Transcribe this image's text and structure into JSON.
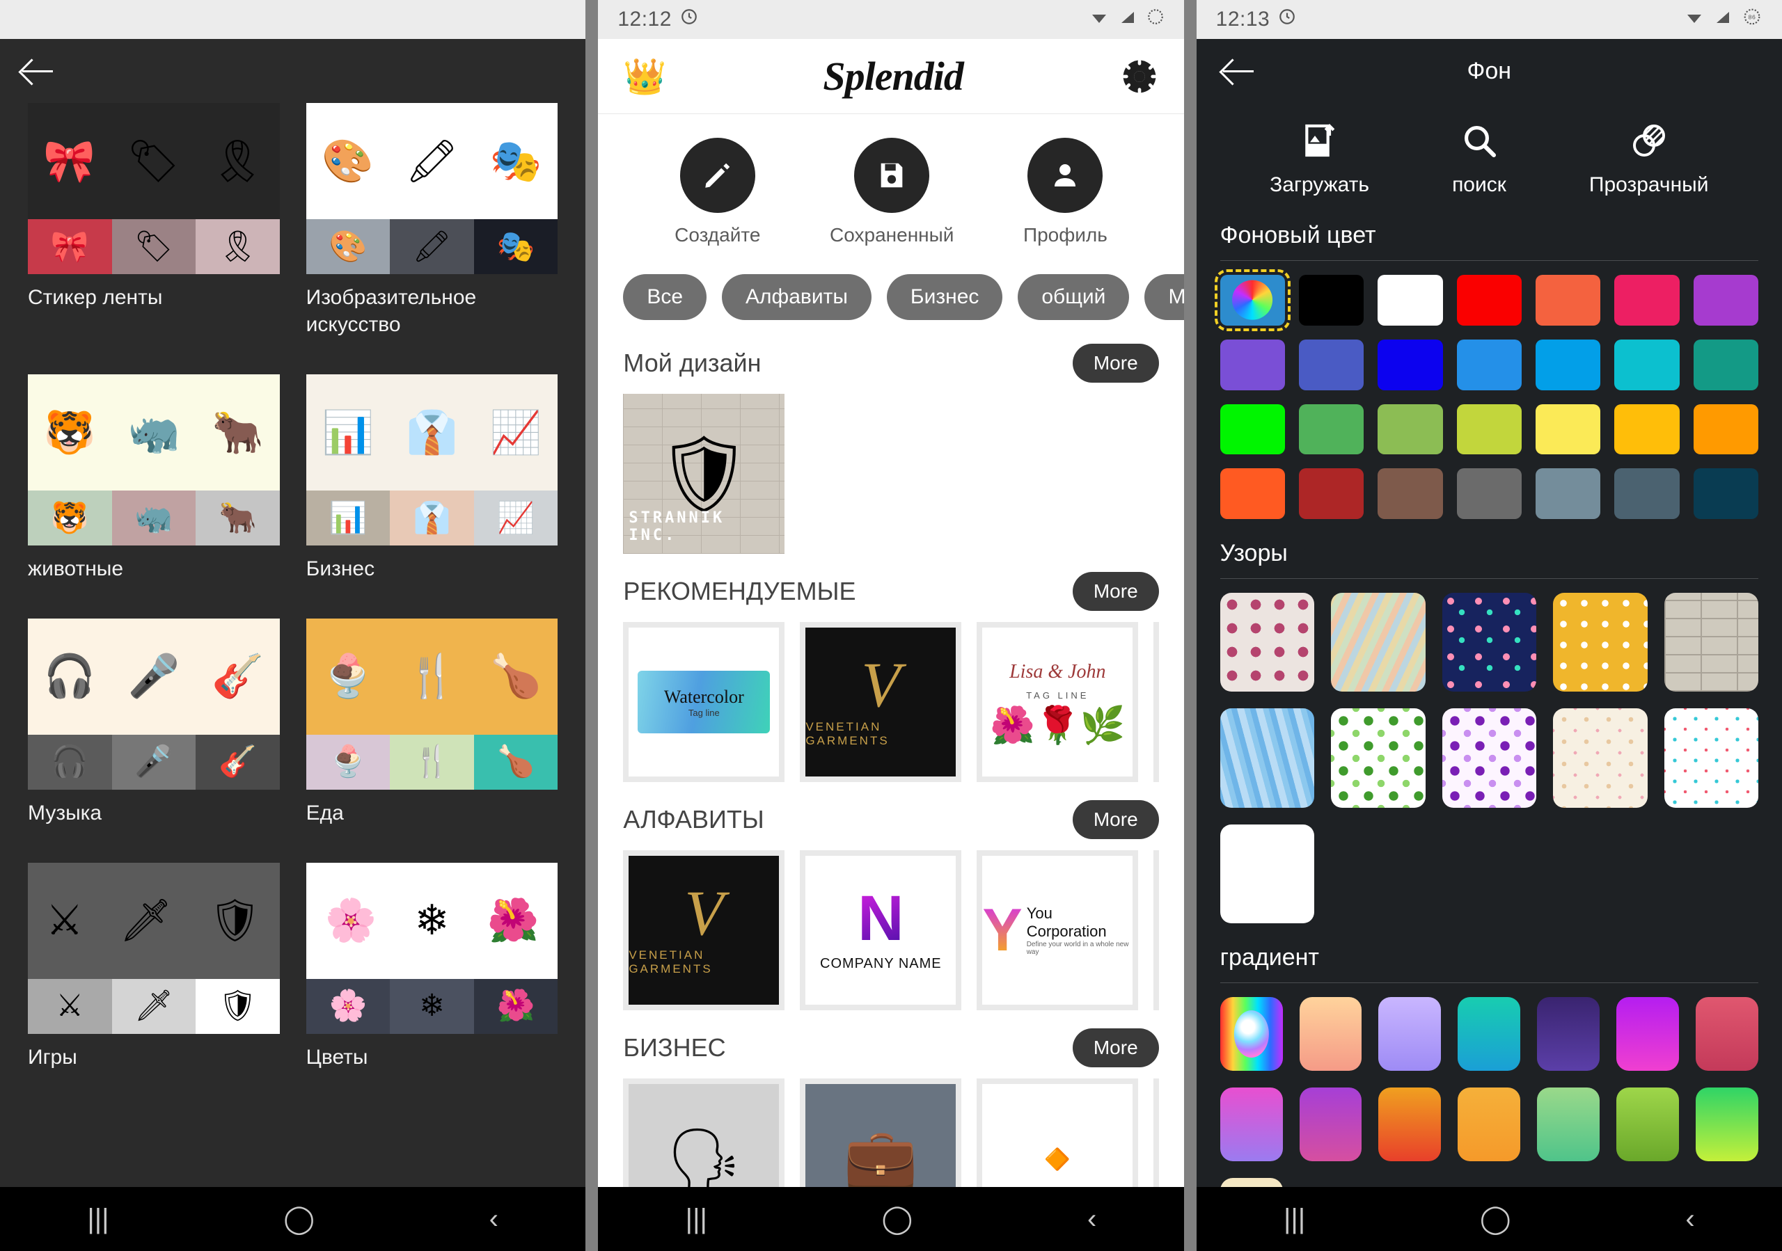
{
  "left": {
    "statusbar": {},
    "back_icon": "arrow-left-icon",
    "categories": [
      {
        "label": "Стикер ленты",
        "icons": [
          "🎀",
          "🏷",
          "🎗"
        ],
        "big_bg": "#262626",
        "cells": [
          "#c73a4a",
          "#9b8285",
          "#cdb4b7"
        ]
      },
      {
        "label": "Изобразительное искусство",
        "icons": [
          "🎨",
          "🖍",
          "🎭"
        ],
        "big_bg": "#ffffff",
        "cells": [
          "#9aa2ab",
          "#4c4f57",
          "#1a1d26"
        ]
      },
      {
        "label": "животные",
        "icons": [
          "🐯",
          "🦏",
          "🐂"
        ],
        "big_bg": "#fbfbe6",
        "cells": [
          "#bdd0bc",
          "#c0a2a2",
          "#c5c5c5"
        ]
      },
      {
        "label": "Бизнес",
        "icons": [
          "📊",
          "👔",
          "📈"
        ],
        "big_bg": "#f6f1e8",
        "cells": [
          "#b9b0a2",
          "#e8c9b6",
          "#cfd3d6"
        ]
      },
      {
        "label": "Музыка",
        "icons": [
          "🎧",
          "🎤",
          "🎸"
        ],
        "big_bg": "#fdf3e4",
        "cells": [
          "#5b5b5b",
          "#777777",
          "#4a4a4a"
        ]
      },
      {
        "label": "Еда",
        "icons": [
          "🍨",
          "🍴",
          "🍗"
        ],
        "big_bg": "#f0b44d",
        "cells": [
          "#d8c7d6",
          "#cfe3b8",
          "#39bfae"
        ]
      },
      {
        "label": "Игры",
        "icons": [
          "⚔",
          "🗡",
          "🛡"
        ],
        "big_bg": "#5b5b5b",
        "cells": [
          "#a9a9a9",
          "#d4d4d4",
          "#ffffff"
        ]
      },
      {
        "label": "Цветы",
        "icons": [
          "🌸",
          "❄",
          "🌺"
        ],
        "big_bg": "#ffffff",
        "cells": [
          "#3d4250",
          "#4b5160",
          "#2f3440"
        ]
      }
    ]
  },
  "mid": {
    "statusbar": {
      "time": "12:12"
    },
    "header": {
      "crown": "👑",
      "brand": "Splendid",
      "settings_icon": "gear-icon"
    },
    "actions": [
      {
        "label": "Создайте",
        "icon": "pencil-icon"
      },
      {
        "label": "Сохраненный",
        "icon": "save-icon"
      },
      {
        "label": "Профиль",
        "icon": "person-icon"
      }
    ],
    "chips": [
      "Все",
      "Алфавиты",
      "Бизнес",
      "общий",
      "Музыка"
    ],
    "sections": [
      {
        "title": "Мой дизайн",
        "more": "More",
        "kind": "mydesign",
        "items": [
          {
            "brand": "STRANNIK INC.",
            "emblem": "🛡"
          }
        ]
      },
      {
        "title": "РЕКОМЕНДУЕМЫЕ",
        "more": "More",
        "kind": "logos",
        "items": [
          {
            "type": "watercolor",
            "name": "Watercolor",
            "tagline": "Tag line"
          },
          {
            "type": "venetian",
            "letter": "V",
            "name": "VENETIAN GARMENTS"
          },
          {
            "type": "floral",
            "name": "Lisa & John",
            "tagline": "TAG LINE"
          }
        ]
      },
      {
        "title": "АЛФАВИТЫ",
        "more": "More",
        "kind": "logos",
        "items": [
          {
            "type": "venetian",
            "letter": "V",
            "name": "VENETIAN GARMENTS"
          },
          {
            "type": "nbrush",
            "letter": "N",
            "name": "COMPANY NAME"
          },
          {
            "type": "ycorp",
            "letter": "Y",
            "name": "You Corporation",
            "tagline": "Define your world in a whole new way"
          }
        ]
      },
      {
        "title": "БИЗНЕС",
        "more": "More",
        "kind": "logos",
        "items": [
          {
            "type": "meeting",
            "icon": "💬"
          },
          {
            "type": "briefcase",
            "icon": "💼"
          },
          {
            "type": "ribbonmark",
            "icon": "🔶"
          }
        ]
      }
    ]
  },
  "right": {
    "statusbar": {
      "time": "12:13",
      "battery": "86"
    },
    "appbar": {
      "back_icon": "arrow-left-icon",
      "title": "Фон"
    },
    "tools": [
      {
        "label": "Загружать",
        "icon": "image-upload-icon"
      },
      {
        "label": "поиск",
        "icon": "search-icon"
      },
      {
        "label": "Прозрачный",
        "icon": "transparency-icon"
      }
    ],
    "bg_color": {
      "title": "Фоновый цвет",
      "selected_index": 0,
      "swatches": [
        "picker",
        "#000000",
        "#ffffff",
        "#fa0000",
        "#f4623f",
        "#ed1f63",
        "#a63bcf",
        "#7a4fd6",
        "#4a5bc4",
        "#0c02ef",
        "#2490e8",
        "#029fe8",
        "#0cc0cf",
        "#139a86",
        "#00f500",
        "#50b25a",
        "#8cbd54",
        "#c2d63c",
        "#fbea57",
        "#ffbe09",
        "#ff9a00",
        "#ff5a22",
        "#ad2626",
        "#7e5a4b",
        "#6b6b6b",
        "#748d9b",
        "#4b6270",
        "#093c52"
      ]
    },
    "patterns": {
      "title": "Узоры",
      "items": [
        "polka-dots-pink",
        "feather-leaves",
        "flamingo-navy",
        "daisy-yellow",
        "brick-wall",
        "blue-streaks",
        "green-dots",
        "purple-dots",
        "sweets-cream",
        "summer-icons",
        "blank"
      ]
    },
    "gradient": {
      "title": "градиент",
      "items": [
        "picker",
        "linear-gradient(180deg,#ffd39c,#f59b87)",
        "linear-gradient(180deg,#c9b6ff,#9e8bf5)",
        "linear-gradient(180deg,#18cdb0,#1a9fd6)",
        "linear-gradient(180deg,#3a2470,#5b3fa8)",
        "linear-gradient(180deg,#b51ef0,#f03fd0)",
        "linear-gradient(180deg,#e0576f,#c43a5a)",
        "linear-gradient(180deg,#e84fd0,#9b7bf0)",
        "linear-gradient(180deg,#a63fd6,#d64fa0)",
        "linear-gradient(180deg,#f0a020,#e8402a)",
        "linear-gradient(180deg,#f5b03a,#f59a2a)",
        "linear-gradient(180deg,#9ad98a,#4fc48a)",
        "linear-gradient(180deg,#9ed64a,#6aa82a)",
        "linear-gradient(180deg,#2fd466,#c4f03a)",
        "linear-gradient(180deg,#f5e6c0,#eef7ec)"
      ]
    }
  },
  "navbar": {
    "recents": "|||",
    "home": "◯",
    "back": "‹"
  }
}
